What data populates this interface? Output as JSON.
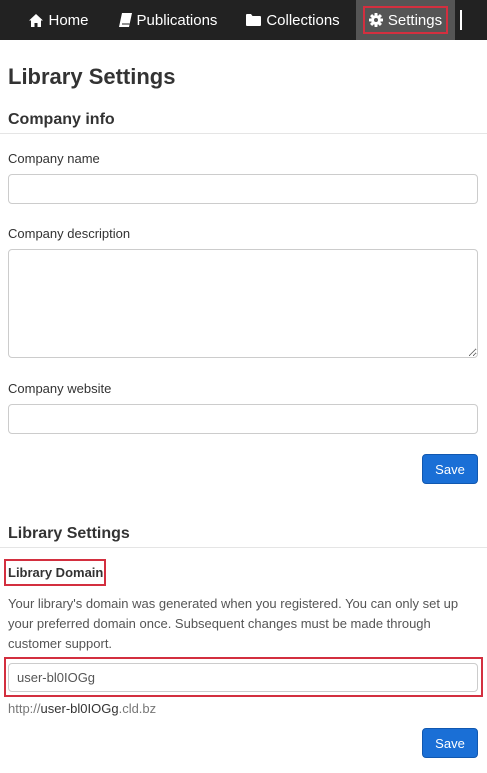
{
  "nav": {
    "home": "Home",
    "publications": "Publications",
    "collections": "Collections",
    "settings": "Settings"
  },
  "page": {
    "title": "Library Settings"
  },
  "company": {
    "heading": "Company info",
    "name_label": "Company name",
    "name_value": "",
    "description_label": "Company description",
    "description_value": "",
    "website_label": "Company website",
    "website_value": "",
    "save_label": "Save"
  },
  "library": {
    "heading": "Library Settings",
    "domain_label": "Library Domain",
    "help_text": "Your library's domain was generated when you registered. You can only set up your preferred domain once. Subsequent changes must be made through customer support.",
    "domain_value": "user-bl0IOGg",
    "url_prefix": "http://",
    "url_subdomain": "user-bl0IOGg",
    "url_suffix": ".cld.bz",
    "save_label": "Save"
  },
  "colors": {
    "navbar_bg": "#222222",
    "nav_active_bg": "#555555",
    "primary_button": "#1a6fd6",
    "highlight": "#d32f3f"
  },
  "icons": {
    "home": "home-icon",
    "publications": "book-icon",
    "collections": "folder-icon",
    "settings": "gear-icon"
  }
}
